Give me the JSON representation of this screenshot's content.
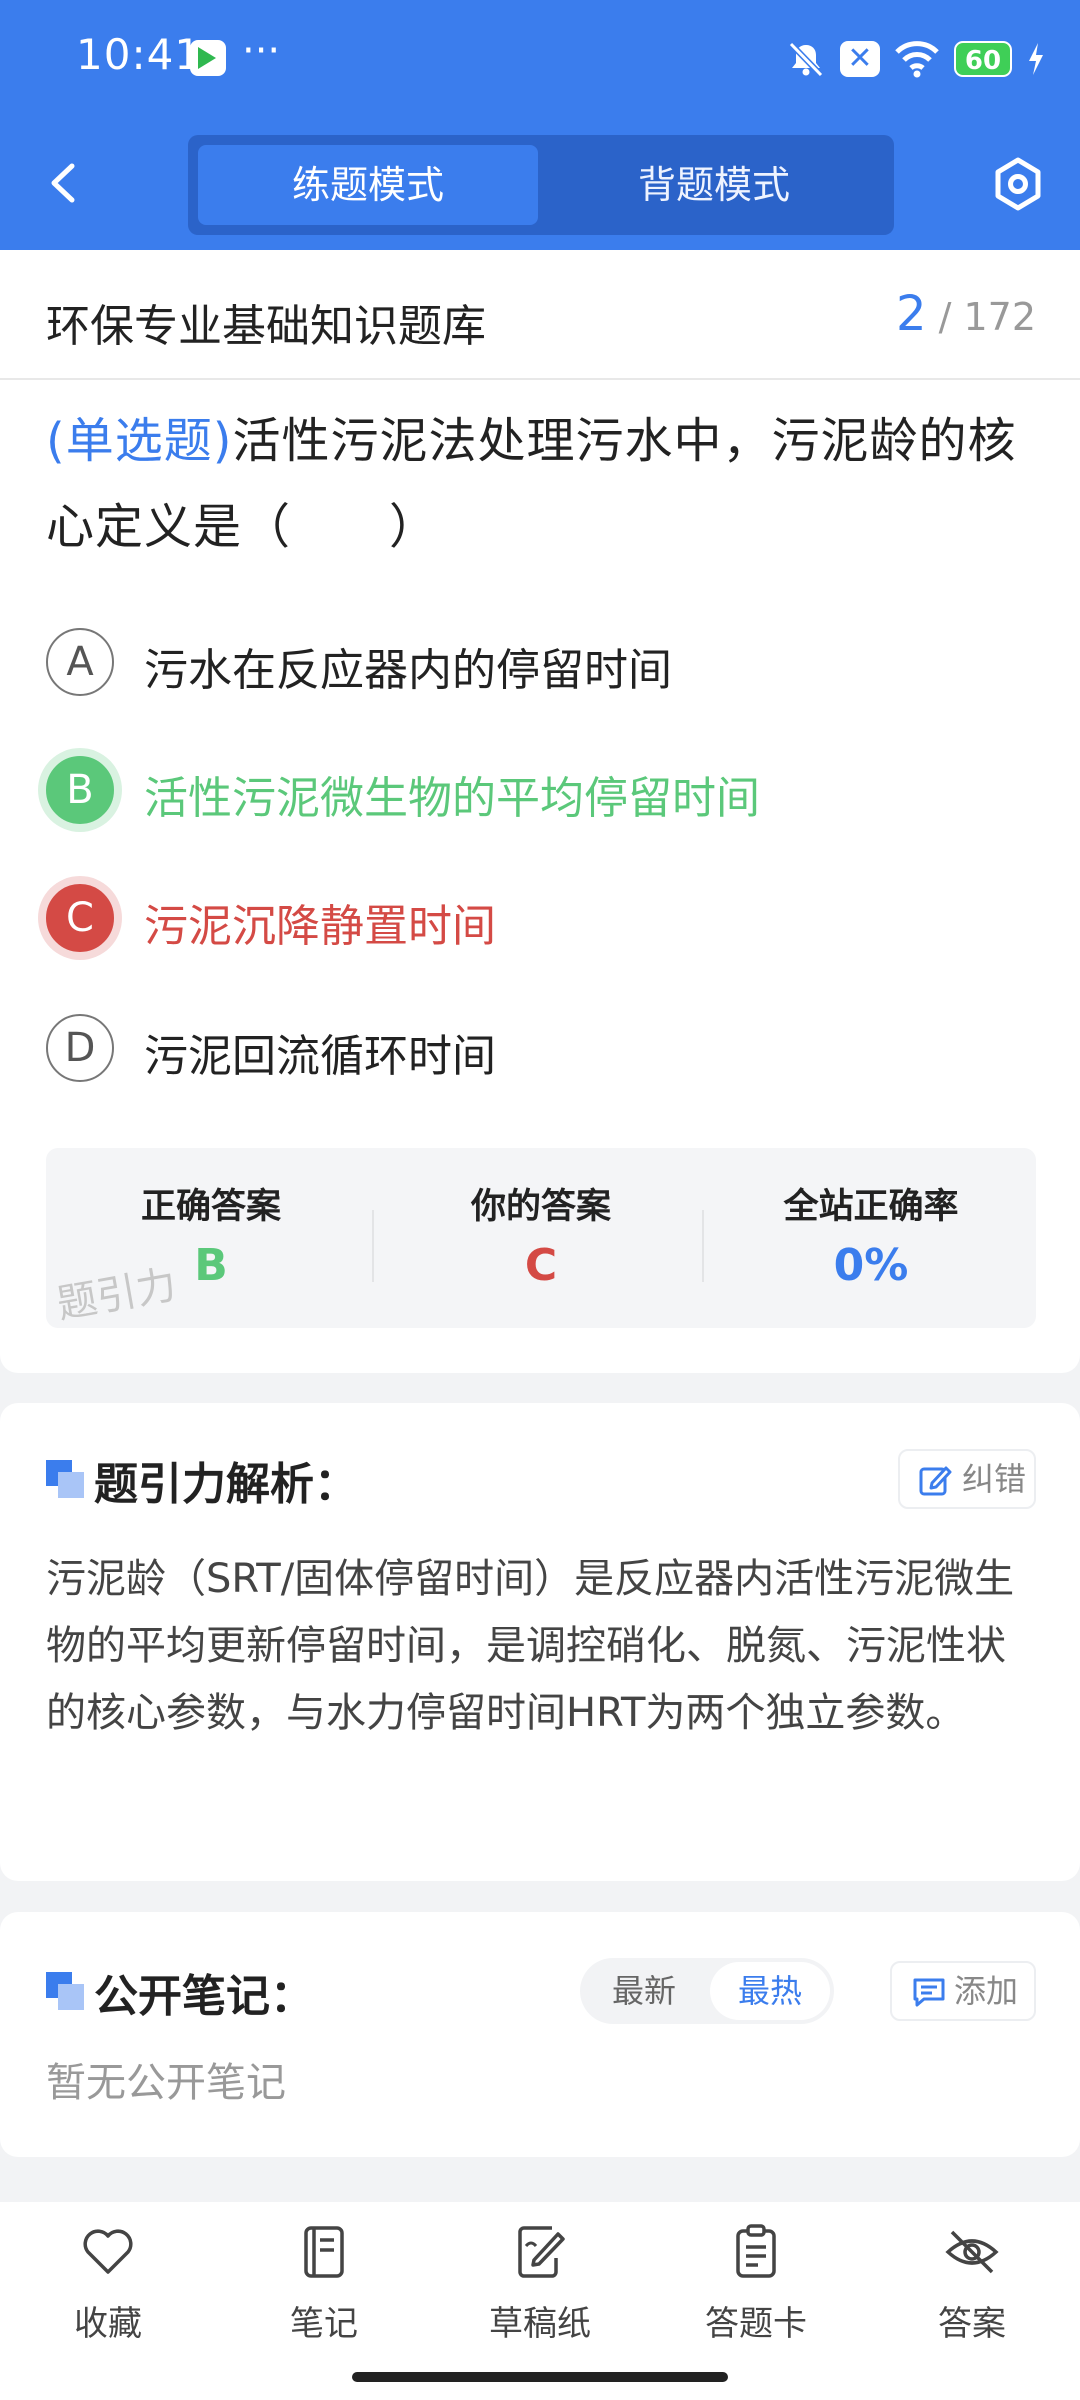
{
  "status_bar": {
    "time": "10:41",
    "more": "···",
    "battery": "60"
  },
  "header": {
    "tabs": [
      {
        "label": "练题模式"
      },
      {
        "label": "背题模式"
      }
    ]
  },
  "bank": {
    "title": "环保专业基础知识题库",
    "current": "2",
    "total": "/ 172"
  },
  "question": {
    "type": "(单选题)",
    "text": "活性污泥法处理污水中，污泥龄的核心定义是（　　）",
    "options": [
      {
        "letter": "A",
        "text": "污水在反应器内的停留时间"
      },
      {
        "letter": "B",
        "text": "活性污泥微生物的平均停留时间"
      },
      {
        "letter": "C",
        "text": "污泥沉降静置时间"
      },
      {
        "letter": "D",
        "text": "污泥回流循环时间"
      }
    ]
  },
  "answer_summary": {
    "correct_label": "正确答案",
    "correct_value": "B",
    "yours_label": "你的答案",
    "yours_value": "C",
    "rate_label": "全站正确率",
    "rate_value": "0%",
    "watermark": "题引力"
  },
  "analysis": {
    "title": "题引力解析：",
    "correct_button": "纠错",
    "text": "污泥龄（SRT/固体停留时间）是反应器内活性污泥微生物的平均更新停留时间，是调控硝化、脱氮、污泥性状的核心参数，与水力停留时间HRT为两个独立参数。"
  },
  "notes": {
    "title": "公开笔记：",
    "sort_latest": "最新",
    "sort_hot": "最热",
    "add_button": "添加",
    "empty_text": "暂无公开笔记"
  },
  "bottom_nav": [
    {
      "label": "收藏",
      "icon": "heart-icon"
    },
    {
      "label": "笔记",
      "icon": "notebook-icon"
    },
    {
      "label": "草稿纸",
      "icon": "draft-icon"
    },
    {
      "label": "答题卡",
      "icon": "answer-card-icon"
    },
    {
      "label": "答案",
      "icon": "eye-off-icon"
    }
  ],
  "colors": {
    "primary": "#3b7ded",
    "correct": "#5bc87a",
    "wrong": "#d44a45"
  }
}
